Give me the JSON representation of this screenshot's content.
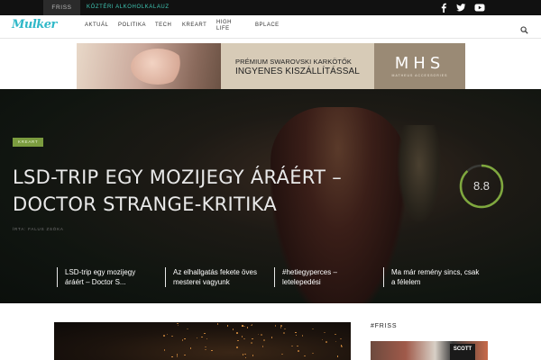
{
  "topbar": {
    "friss_label": "FRISS",
    "ticker_text": "KÖZTÉRI ALKOHOLKALAUZ",
    "social_icons": [
      "facebook-icon",
      "twitter-icon",
      "youtube-icon"
    ]
  },
  "nav": {
    "logo": "Mulker",
    "items": [
      "AKTUÁL",
      "POLITIKA",
      "TECH",
      "KREART",
      "HIGH LIFE",
      "BPLACE"
    ]
  },
  "banner": {
    "line1": "PRÉMIUM SWAROVSKI KARKÖTŐK",
    "line2": "INGYENES KISZÁLLÍTÁSSAL",
    "brand": "MHS",
    "brand_sub": "MATHEUS ACCESSORIES"
  },
  "hero": {
    "category": "KREART",
    "title": "LSD-TRIP EGY MOZIJEGY ÁRÁÉRT – DOCTOR STRANGE-KRITIKA",
    "author": "ÍRTA: FALUS ZSÓKA",
    "score": 8.8,
    "score_label": "8.8"
  },
  "related": [
    "LSD-trip egy mozijegy áráért – Doctor S...",
    "Az elhallgatás fekete öves mesterei vagyunk",
    "#hetiegyperces – letelepedési",
    "Ma már remény sincs, csak a félelem"
  ],
  "sidebar": {
    "friss_heading": "#FRISS",
    "sign_text": "SCOTT"
  },
  "colors": {
    "accent_teal": "#2fb8c8",
    "category_green": "#7b9c3f",
    "score_ring": "#7fa83e"
  }
}
